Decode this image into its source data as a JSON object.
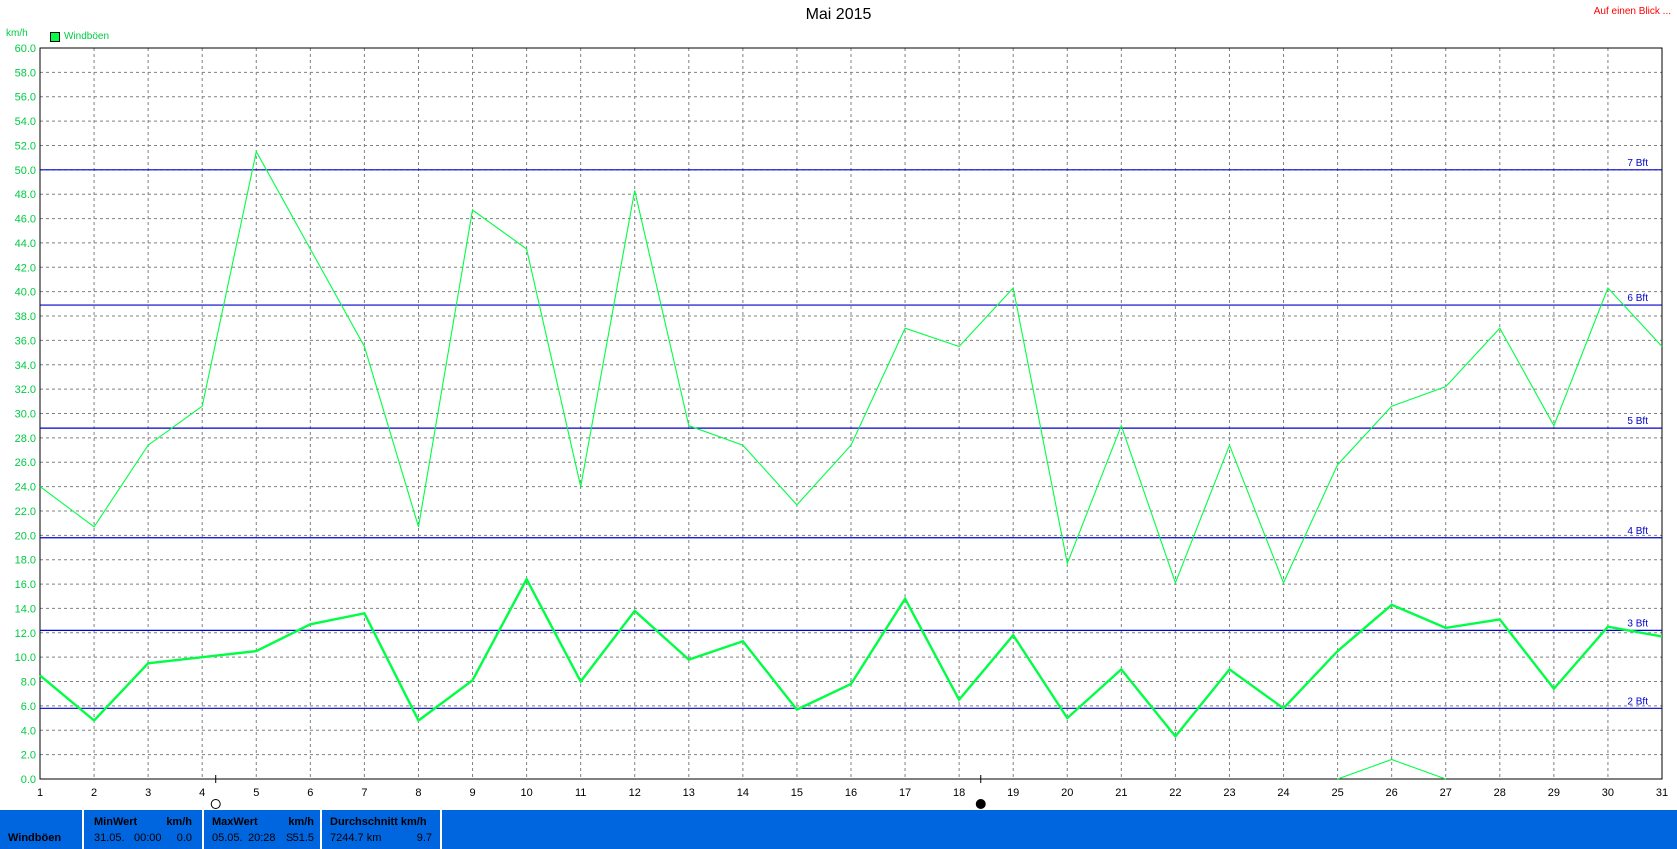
{
  "page": {
    "title": "Mai 2015",
    "link": "Auf einen Blick ...",
    "unit": "km/h"
  },
  "legend": {
    "label": "Windböen",
    "color": "#00ff44"
  },
  "chart_data": {
    "type": "line",
    "x": [
      1,
      2,
      3,
      4,
      5,
      6,
      7,
      8,
      9,
      10,
      11,
      12,
      13,
      14,
      15,
      16,
      17,
      18,
      19,
      20,
      21,
      22,
      23,
      24,
      25,
      26,
      27,
      28,
      29,
      30,
      31
    ],
    "xlim": [
      1,
      31
    ],
    "ylim": [
      0,
      60
    ],
    "yticks": [
      0,
      2,
      4,
      6,
      8,
      10,
      12,
      14,
      16,
      18,
      20,
      22,
      24,
      26,
      28,
      30,
      32,
      34,
      36,
      38,
      40,
      42,
      44,
      46,
      48,
      50,
      52,
      54,
      56,
      58,
      60
    ],
    "ytick_labels": [
      "0.0",
      "2.0",
      "4.0",
      "6.0",
      "8.0",
      "10.0",
      "12.0",
      "14.0",
      "16.0",
      "18.0",
      "20.0",
      "22.0",
      "24.0",
      "26.0",
      "28.0",
      "30.0",
      "32.0",
      "34.0",
      "36.0",
      "38.0",
      "40.0",
      "42.0",
      "44.0",
      "46.0",
      "48.0",
      "50.0",
      "52.0",
      "54.0",
      "56.0",
      "58.0",
      "60.0"
    ],
    "grid": true,
    "legend_position": "top-left",
    "series": [
      {
        "name": "Windböen",
        "style": "thin",
        "color": "#00ff44",
        "values": [
          24.0,
          20.7,
          27.4,
          30.6,
          51.5,
          43.5,
          35.5,
          20.7,
          46.7,
          43.5,
          24.0,
          48.3,
          29.0,
          27.4,
          22.5,
          27.4,
          37.0,
          35.5,
          40.3,
          17.7,
          29.0,
          16.1,
          27.4,
          16.1,
          25.8,
          30.6,
          32.2,
          37.0,
          29.0,
          40.3,
          35.5
        ]
      },
      {
        "style": "thick",
        "color": "#00ff44",
        "values": [
          8.5,
          4.8,
          9.5,
          10.0,
          10.5,
          12.7,
          13.6,
          4.8,
          8.1,
          16.4,
          8.0,
          13.8,
          9.8,
          11.3,
          5.7,
          7.8,
          14.8,
          6.5,
          11.8,
          5.0,
          9.0,
          3.5,
          9.0,
          5.8,
          10.5,
          14.3,
          12.4,
          13.1,
          7.4,
          12.5,
          11.7
        ]
      },
      {
        "style": "thin",
        "color": "#00ff44",
        "x": [
          25,
          26,
          27
        ],
        "values": [
          0.0,
          1.6,
          0.0
        ]
      }
    ],
    "reference_lines": [
      {
        "label": "7 Bft",
        "value": 50.0
      },
      {
        "label": "6 Bft",
        "value": 38.9
      },
      {
        "label": "5 Bft",
        "value": 28.8
      },
      {
        "label": "4 Bft",
        "value": 19.8
      },
      {
        "label": "3 Bft",
        "value": 12.2
      },
      {
        "label": "2 Bft",
        "value": 5.8
      }
    ],
    "reference_color": "#0000cc",
    "markers": [
      {
        "x": 4.25,
        "icon": "moon-first-quarter-icon",
        "filled": false
      },
      {
        "x": 18.4,
        "icon": "new-moon-icon",
        "filled": true
      }
    ]
  },
  "footer": {
    "label": "Windböen",
    "min": {
      "header": "MinWert",
      "unit": "km/h",
      "date": "31.05.",
      "time": "00:00",
      "value": "0.0"
    },
    "max": {
      "header": "MaxWert",
      "unit": "km/h",
      "date": "05.05.",
      "time": "20:28",
      "dir": "S",
      "value": "51.5"
    },
    "avg": {
      "header": "Durchschnitt km/h",
      "distance": "7244.7 km",
      "value": "9.7"
    }
  }
}
